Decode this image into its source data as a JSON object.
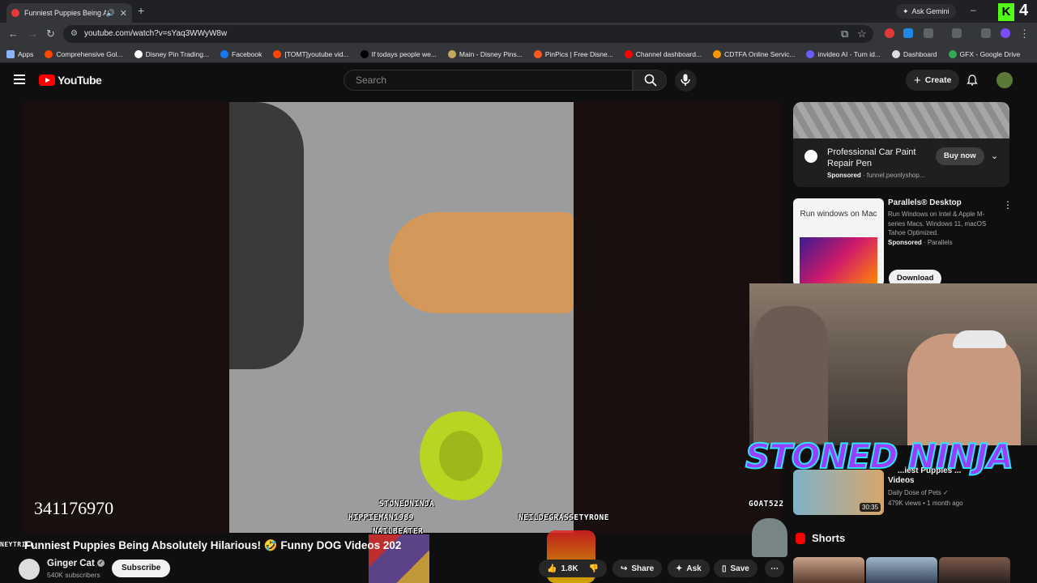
{
  "browser": {
    "tab_title": "Funniest Puppies Being Ab...",
    "new_tab": "+",
    "url": "youtube.com/watch?v=sYaq3WWyW8w",
    "ask_gemini": "Ask Gemini",
    "k_badge": "K",
    "k_num": "4",
    "bookmarks": [
      {
        "label": "Apps",
        "icon": "apps-icon",
        "color": "#8ab4f8"
      },
      {
        "label": "Comprehensive Gol...",
        "icon": "reddit-icon",
        "color": "#ff4500"
      },
      {
        "label": "Disney Pin Trading...",
        "icon": "globe-icon",
        "color": "#ffffff"
      },
      {
        "label": "Facebook",
        "icon": "facebook-icon",
        "color": "#1877f2"
      },
      {
        "label": "[TOMT]youtube vid...",
        "icon": "reddit-icon",
        "color": "#ff4500"
      },
      {
        "label": "If todays people we...",
        "icon": "tiktok-icon",
        "color": "#000000"
      },
      {
        "label": "Main - Disney Pins...",
        "icon": "pin-icon",
        "color": "#c8a860"
      },
      {
        "label": "PinPics | Free Disne...",
        "icon": "pinpics-icon",
        "color": "#ff5722"
      },
      {
        "label": "Channel dashboard...",
        "icon": "youtube-icon",
        "color": "#ff0000"
      },
      {
        "label": "CDTFA Online Servic...",
        "icon": "cdtfa-icon",
        "color": "#ff9800"
      },
      {
        "label": "invideo AI - Turn id...",
        "icon": "invideo-icon",
        "color": "#6a5cff"
      },
      {
        "label": "Dashboard",
        "icon": "dashboard-icon",
        "color": "#dddddd"
      },
      {
        "label": "GFX - Google Drive",
        "icon": "drive-icon",
        "color": "#34a853"
      }
    ]
  },
  "youtube": {
    "logo_text": "YouTube",
    "search_placeholder": "Search",
    "create_label": "Create"
  },
  "video": {
    "title": "Funniest Puppies Being Absolutely Hilarious! 🤣 Funny DOG Videos 202",
    "overlay_counter": "341176970",
    "overlay_names": [
      "STONEDNINJA",
      "HIPPIEMAN1989",
      "NAILBEATER",
      "NEILDEGRASSETYRONE",
      "GOAT522",
      "NEYTRILL"
    ],
    "channel_name": "Ginger Cat",
    "subscribers": "540K subscribers",
    "subscribe_label": "Subscribe",
    "likes": "1.8K",
    "share_label": "Share",
    "ask_label": "Ask",
    "save_label": "Save"
  },
  "sidebar": {
    "ad1": {
      "title": "Professional Car Paint Repair Pen",
      "sponsored": "Sponsored",
      "domain": "funnel.peonlyshop...",
      "button": "Buy now"
    },
    "ad2": {
      "image_caption": "Run windows on Mac",
      "title": "Parallels® Desktop",
      "description": "Run Windows on Intel & Apple M-series Macs. Windows 11, macOS Tahoe Optimized.",
      "sponsored": "Sponsored",
      "advertiser": "Parallels",
      "button": "Download"
    },
    "related": {
      "title_line1": "...iest Puppies ...",
      "title_line2": "Videos",
      "channel": "Daily Dose of Pets",
      "meta": "479K views • 1 month ago",
      "duration": "30:35"
    },
    "shorts_label": "Shorts"
  },
  "stream_overlay": {
    "banner": "STONED NINJA"
  }
}
